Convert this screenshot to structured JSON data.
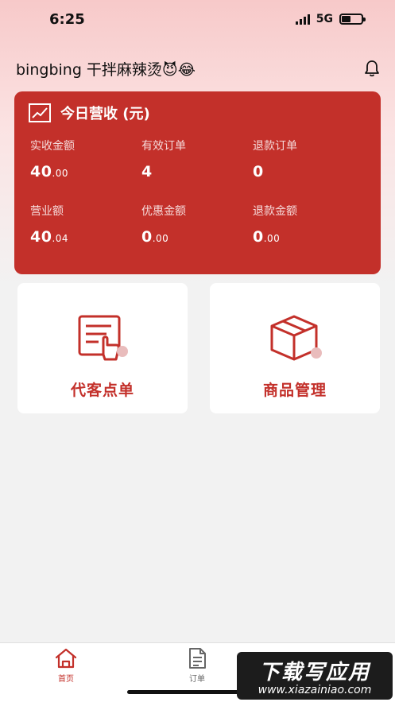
{
  "status_bar": {
    "time": "6:25",
    "network": "5G"
  },
  "header": {
    "shop_name": "bingbing 干拌麻辣烫😈😂"
  },
  "revenue": {
    "title": "今日营收 (元)",
    "stats": [
      {
        "label": "实收金额",
        "int": "40",
        "dec": ".00"
      },
      {
        "label": "有效订单",
        "int": "4",
        "dec": ""
      },
      {
        "label": "退款订单",
        "int": "0",
        "dec": ""
      },
      {
        "label": "营业额",
        "int": "40",
        "dec": ".04"
      },
      {
        "label": "优惠金额",
        "int": "0",
        "dec": ".00"
      },
      {
        "label": "退款金额",
        "int": "0",
        "dec": ".00"
      }
    ]
  },
  "tiles": [
    {
      "label": "代客点单",
      "icon": "order-for-customer-icon"
    },
    {
      "label": "商品管理",
      "icon": "product-box-icon"
    }
  ],
  "tabbar": [
    {
      "label": "首页",
      "icon": "home-icon"
    },
    {
      "label": "订单",
      "icon": "document-icon"
    }
  ],
  "watermark": {
    "main": "下载写应用",
    "url": "www.xiazainiao.com"
  },
  "colors": {
    "accent": "#c3302a",
    "background": "#f2f2f2"
  }
}
